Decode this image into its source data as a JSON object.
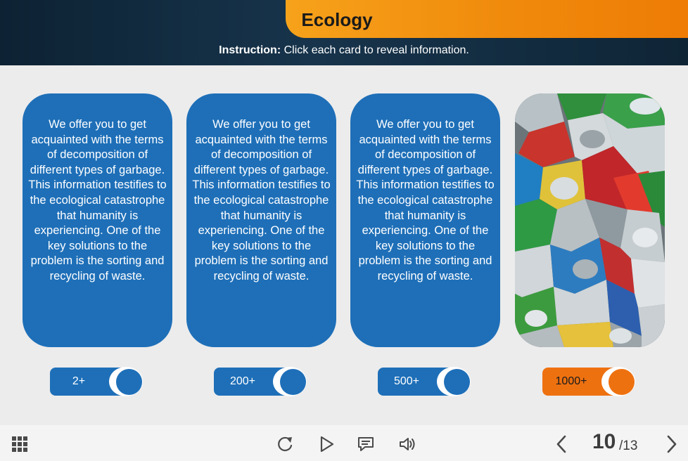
{
  "header": {
    "title": "Ecology",
    "instruction_bold": "Instruction:",
    "instruction_text": " Click each card to reveal information."
  },
  "cards": [
    {
      "text": "We offer you to get acquainted with the terms of decomposition of different types of garbage. This information testifies to the ecological catastrophe that humanity is experiencing. One of the key solutions to the problem is the sorting and recycling of waste."
    },
    {
      "text": "We offer you to get acquainted with the terms of decomposition of different types of garbage. This information testifies to the ecological catastrophe that humanity is experiencing. One of the key solutions to the problem is the sorting and recycling of waste."
    },
    {
      "text": "We offer you to get acquainted with the terms of decomposition of different types of garbage. This information testifies to the ecological catastrophe that humanity is experiencing. One of the key solutions to the problem is the sorting and recycling of waste."
    }
  ],
  "toggles": [
    {
      "label": "2+"
    },
    {
      "label": "200+"
    },
    {
      "label": "500+"
    },
    {
      "label": "1000+"
    }
  ],
  "footer": {
    "page_current": "10",
    "page_total": "/13"
  },
  "colors": {
    "accent_blue": "#1e6fb8",
    "accent_orange": "#ee7110",
    "header_dark": "#0d2233"
  }
}
